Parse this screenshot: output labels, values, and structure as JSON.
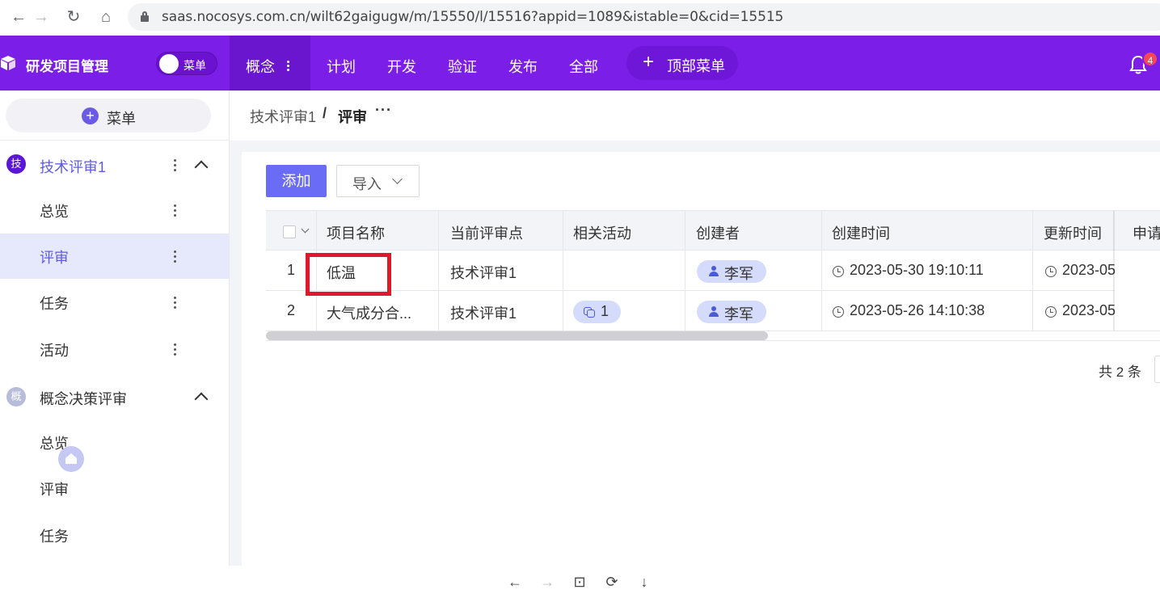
{
  "browser": {
    "url": "saas.nocosys.com.cn/wilt62gaigugw/m/15550/l/15516?appid=1089&istable=0&cid=15515",
    "back_icon": "←",
    "forward_icon": "→",
    "reload_icon": "↻",
    "home_icon": "⌂"
  },
  "appbar": {
    "title": "研发项目管理",
    "toggle_label": "菜单",
    "nav": [
      {
        "label": "概念",
        "active": true
      },
      {
        "label": "计划"
      },
      {
        "label": "开发"
      },
      {
        "label": "验证"
      },
      {
        "label": "发布"
      },
      {
        "label": "全部"
      }
    ],
    "top_menu_label": "顶部菜单",
    "notification_count": "4",
    "accent_color": "#7b1fe8"
  },
  "sidebar": {
    "menu_button_label": "菜单",
    "groups": [
      {
        "icon_char": "技",
        "label": "技术评审1",
        "items": [
          {
            "label": "总览"
          },
          {
            "label": "评审",
            "active": true
          },
          {
            "label": "任务"
          },
          {
            "label": "活动"
          }
        ]
      },
      {
        "icon_char": "概",
        "label": "概念决策评审",
        "items": [
          {
            "label": "总览"
          },
          {
            "label": "评审"
          },
          {
            "label": "任务"
          }
        ]
      }
    ]
  },
  "breadcrumb": {
    "parent": "技术评审1",
    "separator": "/",
    "current": "评审",
    "more": "···"
  },
  "toolbar": {
    "add_label": "添加",
    "import_label": "导入"
  },
  "table": {
    "columns": [
      "项目名称",
      "当前评审点",
      "相关活动",
      "创建者",
      "创建时间",
      "更新时间",
      "申请"
    ],
    "rows": [
      {
        "index": "1",
        "name": "低温",
        "review_point": "技术评审1",
        "activities": "",
        "creator": "李军",
        "created": "2023-05-30 19:10:11",
        "updated": "2023-05"
      },
      {
        "index": "2",
        "name": "大气成分合...",
        "review_point": "技术评审1",
        "activities": "1",
        "creator": "李军",
        "created": "2023-05-26 14:10:38",
        "updated": "2023-05"
      }
    ]
  },
  "footer": {
    "total_label": "共 2 条"
  },
  "bottom_toolbar": [
    "←",
    "→",
    "⊡",
    "⟳",
    "↓"
  ]
}
